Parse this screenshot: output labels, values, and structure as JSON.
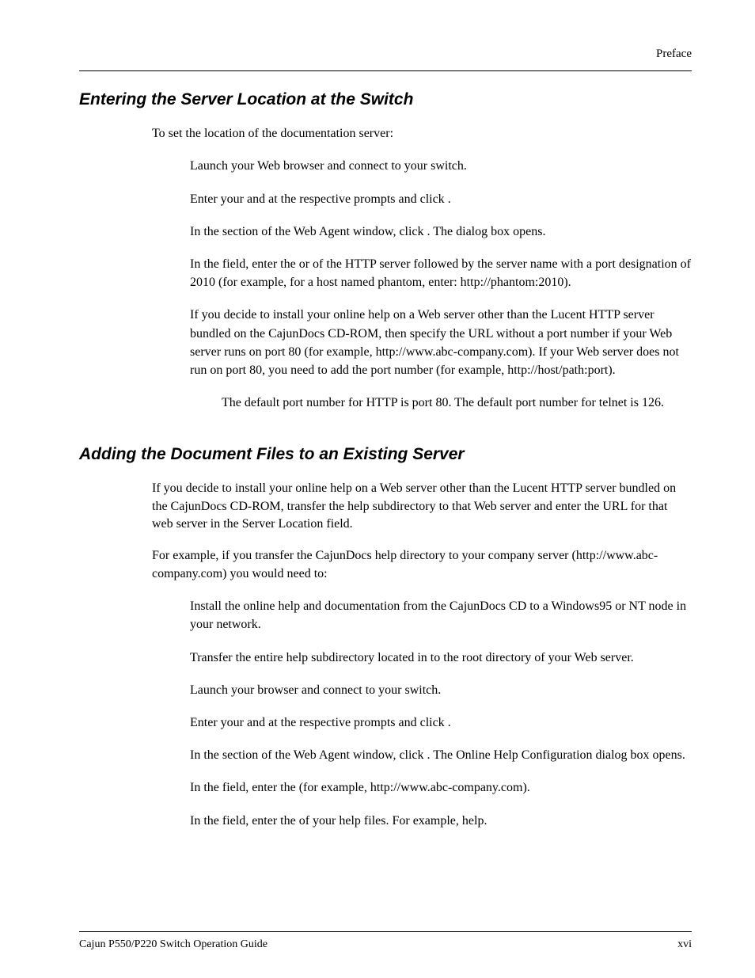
{
  "header": {
    "right_label": "Preface"
  },
  "section1": {
    "title": "Entering the Server Location at the Switch",
    "intro": "To set the location of the documentation server:",
    "steps": {
      "s1": "Launch your Web browser and connect to your switch.",
      "s2a": "Enter your ",
      "s2b": " and ",
      "s2c": " at the respective prompts and click ",
      "s2d": ".",
      "s3a": "In the ",
      "s3b": " section of the Web Agent window, click ",
      "s3c": ". The ",
      "s3d": " dialog box opens.",
      "s4a": "In the ",
      "s4b": " field, enter the ",
      "s4c": " or ",
      "s4d": " of the HTTP server followed by the server name with a port designation of  2010 (for example, for a host named phantom, enter: http://phantom:2010).",
      "s5": "If you decide to install your online help on a Web server other than the Lucent HTTP server bundled on the CajunDocs CD-ROM, then specify the URL without a port number if your Web server runs on port 80 (for example, http://www.abc-company.com). If your Web server does not run on port 80, you need to add the port number (for example, http://host/path:port).",
      "note": "The default port number for HTTP is port 80. The default port number for telnet is 126."
    }
  },
  "section2": {
    "title": "Adding the Document Files to an Existing Server",
    "intro1": "If you decide to install your online help on a Web server other than the Lucent HTTP server bundled on the CajunDocs CD-ROM, transfer the help subdirectory to that Web server and enter the URL for that web server in the Server Location field.",
    "intro2": "For example, if you transfer the CajunDocs help directory to your company server (http://www.abc-company.com) you would need to:",
    "steps": {
      "s1": "Install the online help and documentation from the CajunDocs CD to a Windows95 or NT node in your network.",
      "s2a": "Transfer the entire help subdirectory located in ",
      "s2b": " to the root directory of your Web server.",
      "s3": "Launch your browser and connect to your switch.",
      "s4a": "Enter your ",
      "s4b": " and ",
      "s4c": " at the respective prompts and click ",
      "s4d": ".",
      "s5a": "In the ",
      "s5b": " section of the Web Agent window, click ",
      "s5c": ". The Online Help Configuration dialog box opens.",
      "s6a": "In the ",
      "s6b": " field, enter the ",
      "s6c": " (for example, http://www.abc-company.com).",
      "s7a": "In the ",
      "s7b": " field, enter the ",
      "s7c": " of your help files. For example, help."
    }
  },
  "footer": {
    "left": "Cajun P550/P220 Switch Operation Guide",
    "right": "xvi"
  }
}
